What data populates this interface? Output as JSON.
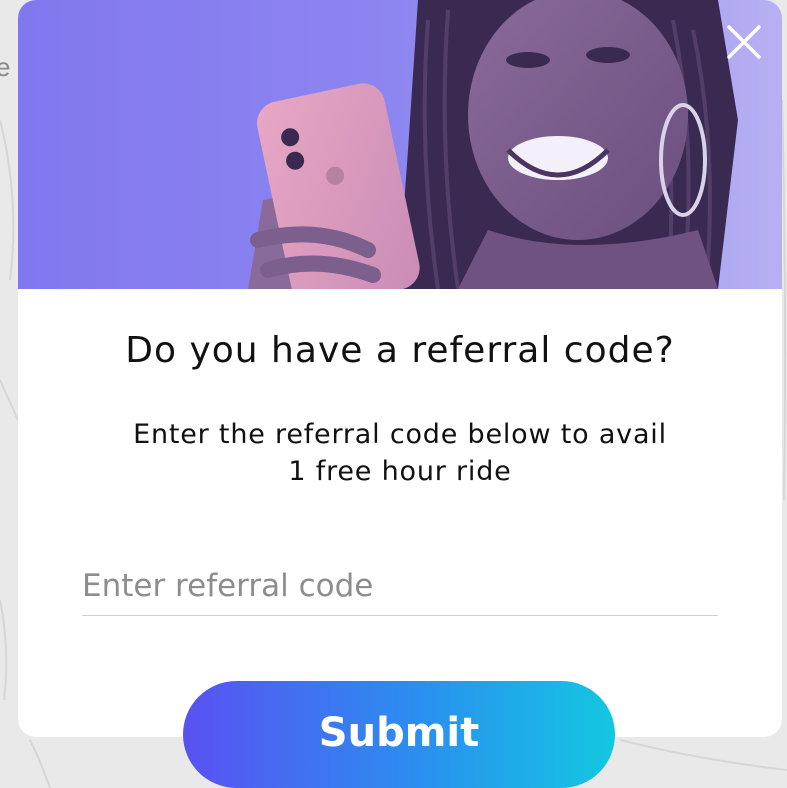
{
  "background": {
    "partial_text": "e"
  },
  "modal": {
    "close_icon": "close-icon",
    "title": "Do you have a referral code?",
    "subtitle_line1": "Enter the referral code below to avail",
    "subtitle_line2": "1 free hour ride",
    "input": {
      "placeholder": "Enter referral code",
      "value": ""
    },
    "submit_label": "Submit"
  },
  "colors": {
    "hero_tint": "#7b73f0",
    "button_gradient_start": "#5a51f2",
    "button_gradient_end": "#13c7e1",
    "text": "#111111"
  }
}
